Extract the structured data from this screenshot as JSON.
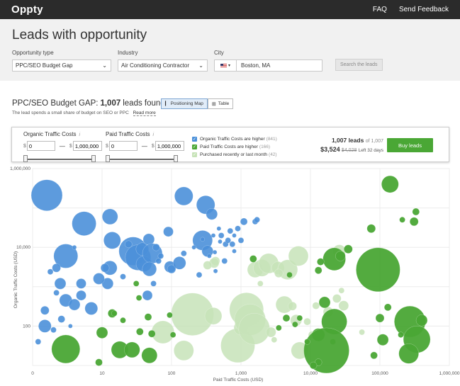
{
  "app": {
    "logo": "Oppty",
    "nav": [
      "FAQ",
      "Send Feedback"
    ]
  },
  "page": {
    "title": "Leads with opportunity"
  },
  "filters": {
    "opportunity_type": {
      "label": "Opportunity type",
      "value": "PPC/SEO Budget Gap"
    },
    "industry": {
      "label": "Industry",
      "value": "Air Conditioning Contractor"
    },
    "city": {
      "label": "City",
      "value": "Boston, MA",
      "flag": "US"
    },
    "search_button": "Search the leads"
  },
  "results": {
    "title_prefix": "PPC/SEO Budget GAP:",
    "count": "1,007",
    "title_suffix": "leads found",
    "subtitle": "The lead spends a small share of budget on SEO or PPC",
    "read_more": "Read more",
    "view_map": "Positioning Map",
    "view_table": "Table"
  },
  "panel": {
    "organic": {
      "label": "Organic Traffic Costs",
      "info": "i",
      "min": "0",
      "max": "1,000,000",
      "currency": "$"
    },
    "paid": {
      "label": "Paid Traffic Costs",
      "info": "i",
      "min": "0",
      "max": "1,000,000",
      "currency": "$"
    },
    "checks": [
      {
        "label": "Organic Traffic Costs are higher",
        "count": "(841)",
        "color": "#4b90d9",
        "checked": true
      },
      {
        "label": "Paid Traffic Costs are higher",
        "count": "(166)",
        "color": "#4aa735",
        "checked": true
      },
      {
        "label": "Purchased recently or last month",
        "count": "(42)",
        "color": "#c7e3b8",
        "checked": true
      }
    ],
    "summary_leads": "1,007 leads",
    "summary_of": "of 1,007",
    "price": "$3,524",
    "old_price": "$4,028",
    "left": "Left 32 days",
    "buy": "Buy leads"
  },
  "chart_data": {
    "type": "scatter",
    "xlabel": "Paid Traffic Costs (USD)",
    "ylabel": "Organic Traffic Costs (USD)",
    "x_scale": "log",
    "y_scale": "log",
    "xlim": [
      1,
      1000000
    ],
    "ylim": [
      10,
      1000000
    ],
    "x_ticks": [
      "0",
      "10",
      "100",
      "1,000",
      "10,000",
      "100,000",
      "1,000,000"
    ],
    "y_ticks": [
      "1,000,000",
      "10,000",
      "100"
    ],
    "grid": true,
    "colors": {
      "organic": "#4b90d9",
      "paid": "#4aa735",
      "recent": "#c7e3b8"
    },
    "series": [
      {
        "name": "Organic Traffic Costs are higher",
        "color": "organic",
        "points": [
          [
            1.6,
            210000,
            22
          ],
          [
            3,
            6000,
            17
          ],
          [
            5.5,
            40000,
            17
          ],
          [
            14,
            15000,
            12
          ],
          [
            13,
            60000,
            11
          ],
          [
            13,
            3000,
            10
          ],
          [
            12,
            1200,
            8
          ],
          [
            28,
            8000,
            20
          ],
          [
            33,
            5500,
            18
          ],
          [
            40,
            3800,
            11
          ],
          [
            38,
            9000,
            9
          ],
          [
            45,
            600,
            7
          ],
          [
            47,
            16000,
            8
          ],
          [
            53,
            7000,
            14
          ],
          [
            48,
            2800,
            10
          ],
          [
            90,
            25000,
            7
          ],
          [
            95,
            3200,
            8
          ],
          [
            100,
            2800,
            6
          ],
          [
            130,
            4000,
            9
          ],
          [
            150,
            200000,
            13
          ],
          [
            310,
            120000,
            13
          ],
          [
            380,
            70000,
            8
          ],
          [
            280,
            15000,
            14
          ],
          [
            330,
            8000,
            8
          ],
          [
            2.5,
            1200,
            8
          ],
          [
            3,
            450,
            9
          ],
          [
            2.2,
            3000,
            6
          ],
          [
            4,
            350,
            8
          ],
          [
            5,
            600,
            7
          ],
          [
            7,
            280,
            9
          ],
          [
            5,
            1200,
            7
          ],
          [
            9,
            1600,
            8
          ],
          [
            11,
            3000,
            6
          ],
          [
            1.5,
            100,
            9
          ],
          [
            1.5,
            250,
            6
          ],
          [
            1.2,
            40,
            4
          ],
          [
            2,
            80,
            4
          ],
          [
            2.6,
            150,
            5
          ],
          [
            3.5,
            100,
            3
          ],
          [
            2.2,
            700,
            4
          ],
          [
            1.8,
            2400,
            4
          ],
          [
            4,
            10000,
            3
          ],
          [
            24,
            12000,
            5
          ],
          [
            20,
            1800,
            4
          ],
          [
            60,
            10000,
            5
          ],
          [
            55,
            1200,
            4
          ],
          [
            65,
            4500,
            4
          ],
          [
            70,
            6000,
            4
          ],
          [
            150,
            7000,
            4
          ],
          [
            210,
            10000,
            3
          ],
          [
            250,
            2000,
            4
          ],
          [
            280,
            16000,
            3
          ],
          [
            350,
            6000,
            3
          ],
          [
            420,
            7500,
            3
          ],
          [
            500,
            14000,
            3
          ],
          [
            520,
            20000,
            4
          ],
          [
            600,
            12000,
            4
          ],
          [
            650,
            15000,
            4
          ],
          [
            700,
            26000,
            4
          ],
          [
            750,
            12000,
            4
          ],
          [
            800,
            20000,
            3
          ],
          [
            900,
            30000,
            4
          ],
          [
            1000,
            15000,
            4
          ],
          [
            1100,
            45000,
            5
          ],
          [
            580,
            4500,
            4
          ],
          [
            480,
            30000,
            3
          ],
          [
            430,
            2500,
            3
          ],
          [
            400,
            20000,
            3
          ],
          [
            1600,
            45000,
            4
          ],
          [
            1700,
            50000,
            4
          ],
          [
            800,
            8000,
            3
          ]
        ]
      },
      {
        "name": "Paid Traffic Costs are higher",
        "color": "paid",
        "points": [
          [
            3,
            26,
            20
          ],
          [
            10,
            68,
            8
          ],
          [
            18,
            25,
            12
          ],
          [
            14,
            210,
            6
          ],
          [
            9,
            12,
            5
          ],
          [
            35,
            72,
            5
          ],
          [
            52,
            64,
            5
          ],
          [
            27,
            25,
            11
          ],
          [
            48,
            18,
            11
          ],
          [
            46,
            170,
            5
          ],
          [
            31,
            1200,
            4
          ],
          [
            34,
            520,
            4
          ],
          [
            20,
            140,
            4
          ],
          [
            15,
            210,
            4
          ],
          [
            94,
            190,
            4
          ],
          [
            105,
            60,
            4
          ],
          [
            1500,
            5100,
            5
          ],
          [
            22000,
            5000,
            16
          ],
          [
            27000,
            6000,
            7
          ],
          [
            35000,
            9000,
            6
          ],
          [
            13000,
            2600,
            5
          ],
          [
            14000,
            4300,
            5
          ],
          [
            16000,
            400,
            8
          ],
          [
            21000,
            40,
            4
          ],
          [
            22000,
            130,
            18
          ],
          [
            13000,
            60,
            9
          ],
          [
            17000,
            24,
            32
          ],
          [
            13000,
            12,
            5
          ],
          [
            94000,
            2700,
            31
          ],
          [
            100000,
            160,
            6
          ],
          [
            130000,
            300,
            5
          ],
          [
            270000,
            130,
            22
          ],
          [
            200000,
            60,
            4
          ],
          [
            340000,
            46,
            19
          ],
          [
            400000,
            140,
            8
          ],
          [
            260000,
            20,
            14
          ],
          [
            110000,
            45,
            8
          ],
          [
            82000,
            18,
            5
          ],
          [
            140000,
            400000,
            12
          ],
          [
            75000,
            30000,
            6
          ],
          [
            310000,
            45000,
            6
          ],
          [
            330000,
            80000,
            5
          ],
          [
            210000,
            50000,
            4
          ],
          [
            11000,
            10,
            5
          ],
          [
            5000,
            2000,
            4
          ],
          [
            4500,
            160,
            5
          ],
          [
            6000,
            110,
            4
          ],
          [
            7000,
            160,
            4
          ],
          [
            3500,
            90,
            4
          ],
          [
            9000,
            40,
            4
          ]
        ]
      },
      {
        "name": "Purchased recently or last month",
        "color": "recent",
        "points": [
          [
            75,
            70,
            16
          ],
          [
            430,
            4500,
            6
          ],
          [
            410,
            4000,
            7
          ],
          [
            330,
            3500,
            6
          ],
          [
            200,
            200,
            30
          ],
          [
            1200,
            260,
            24
          ],
          [
            900,
            32,
            24
          ],
          [
            1000,
            90,
            10
          ],
          [
            1350,
            145,
            22
          ],
          [
            1550,
            85,
            22
          ],
          [
            1600,
            2700,
            11
          ],
          [
            2000,
            3000,
            12
          ],
          [
            2500,
            3900,
            14
          ],
          [
            3400,
            3000,
            9
          ],
          [
            4700,
            2700,
            14
          ],
          [
            6700,
            6000,
            14
          ],
          [
            3500,
            2200,
            6
          ],
          [
            1900,
            1200,
            4
          ],
          [
            4200,
            350,
            12
          ],
          [
            6200,
            140,
            8
          ],
          [
            7000,
            24,
            12
          ],
          [
            9000,
            130,
            5
          ],
          [
            10500,
            60,
            5
          ],
          [
            2700,
            70,
            7
          ],
          [
            3000,
            45,
            4
          ],
          [
            18000,
            230,
            7
          ],
          [
            24000,
            500,
            6
          ],
          [
            30000,
            330,
            7
          ],
          [
            28000,
            800,
            4
          ],
          [
            55000,
            70,
            4
          ],
          [
            26000,
            8000,
            9
          ],
          [
            5500,
            320,
            6
          ],
          [
            150,
            24,
            14
          ],
          [
            400,
            180,
            12
          ],
          [
            12000,
            330,
            5
          ]
        ]
      }
    ]
  }
}
